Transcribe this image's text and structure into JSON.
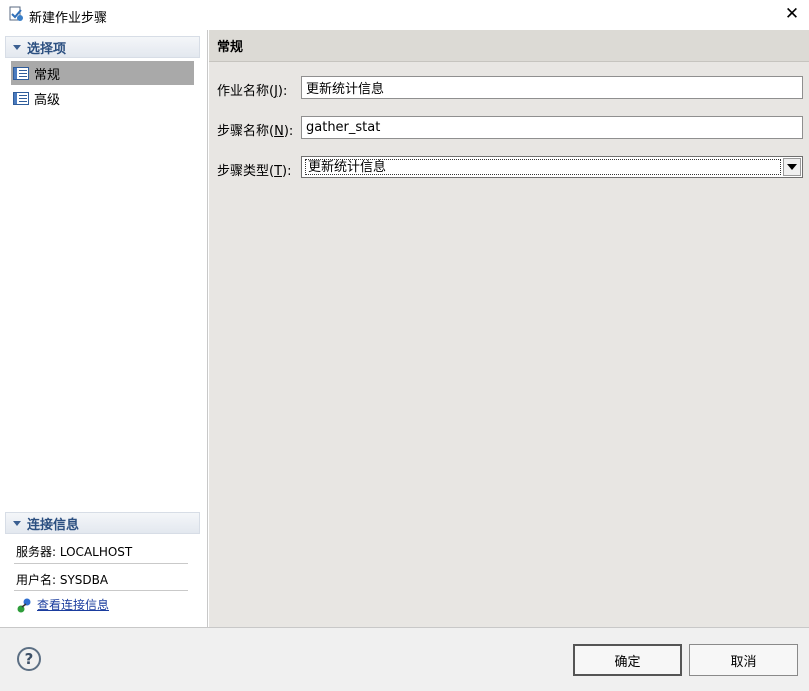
{
  "window": {
    "title": "新建作业步骤",
    "close_label": "✕"
  },
  "left": {
    "options_header": "选择项",
    "items": [
      {
        "label": "常规",
        "selected": true
      },
      {
        "label": "高级",
        "selected": false
      }
    ],
    "conn_header": "连接信息",
    "server": "服务器: LOCALHOST",
    "user": "用户名: SYSDBA",
    "link": "查看连接信息"
  },
  "right": {
    "title": "常规",
    "job_name": {
      "label": "作业名称(",
      "accel": "J",
      "suffix": "):",
      "value": "更新统计信息"
    },
    "step_name": {
      "label": "步骤名称(",
      "accel": "N",
      "suffix": "):",
      "value": "gather_stat"
    },
    "step_type": {
      "label": "步骤类型(",
      "accel": "T",
      "suffix": "):",
      "value": "更新统计信息"
    }
  },
  "footer": {
    "help": "?",
    "ok": "确定",
    "cancel": "取消"
  }
}
